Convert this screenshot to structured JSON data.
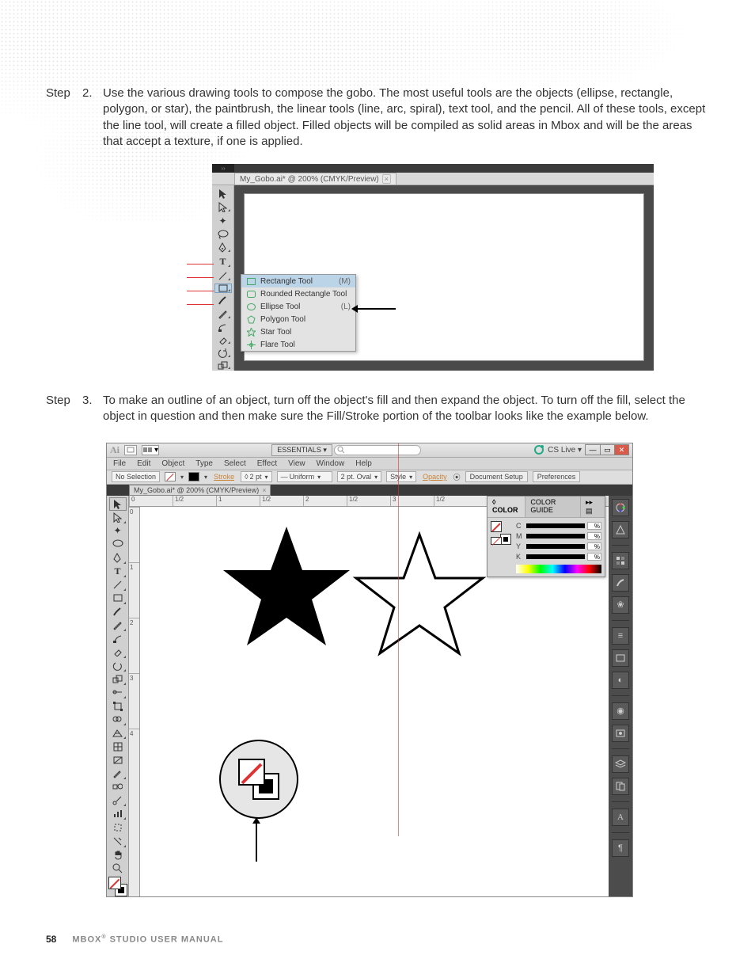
{
  "steps": [
    {
      "label": "Step",
      "num": "2.",
      "text": "Use the various drawing tools to compose the gobo. The most useful tools are the objects (ellipse, rectangle, polygon, or star), the paintbrush, the linear tools (line, arc, spiral), text tool, and the pencil. All of these tools, except the line tool, will create a filled object. Filled objects will be compiled as solid areas in Mbox and will be the areas that accept a texture, if one is applied."
    },
    {
      "label": "Step",
      "num": "3.",
      "text": "To make an outline of an object, turn off the object's fill and then expand the object. To turn off the fill, select the object in question and then make sure the Fill/Stroke portion of the toolbar looks like the example below."
    }
  ],
  "fig1": {
    "document_tab": "My_Gobo.ai* @ 200% (CMYK/Preview)",
    "flyout": [
      {
        "label": "Rectangle Tool",
        "key": "(M)"
      },
      {
        "label": "Rounded Rectangle Tool",
        "key": ""
      },
      {
        "label": "Ellipse Tool",
        "key": "(L)"
      },
      {
        "label": "Polygon Tool",
        "key": ""
      },
      {
        "label": "Star Tool",
        "key": ""
      },
      {
        "label": "Flare Tool",
        "key": ""
      }
    ]
  },
  "fig2": {
    "essentials": "ESSENTIALS",
    "cslive": "CS Live",
    "menus": [
      "File",
      "Edit",
      "Object",
      "Type",
      "Select",
      "Effect",
      "View",
      "Window",
      "Help"
    ],
    "optbar": {
      "nosel": "No Selection",
      "stroke": "Stroke",
      "stroke_pt": "2 pt",
      "uniform": "Uniform",
      "brush": "2 pt. Oval",
      "style": "Style",
      "opacity": "Opacity",
      "docsetup": "Document Setup",
      "prefs": "Preferences"
    },
    "tab": "My_Gobo.ai* @ 200% (CMYK/Preview)",
    "ruler_h": [
      "0",
      "1/2",
      "1",
      "1/2",
      "2",
      "1/2",
      "3",
      "1/2"
    ],
    "ruler_v": [
      "0",
      "1",
      "2",
      "3",
      "4"
    ],
    "color_panel": {
      "tab1": "◊ COLOR",
      "tab2": "COLOR GUIDE",
      "channels": [
        "C",
        "M",
        "Y",
        "K"
      ],
      "val": "%"
    }
  },
  "footer": {
    "page": "58",
    "title_a": "MBOX",
    "title_b": " STUDIO USER MANUAL"
  }
}
